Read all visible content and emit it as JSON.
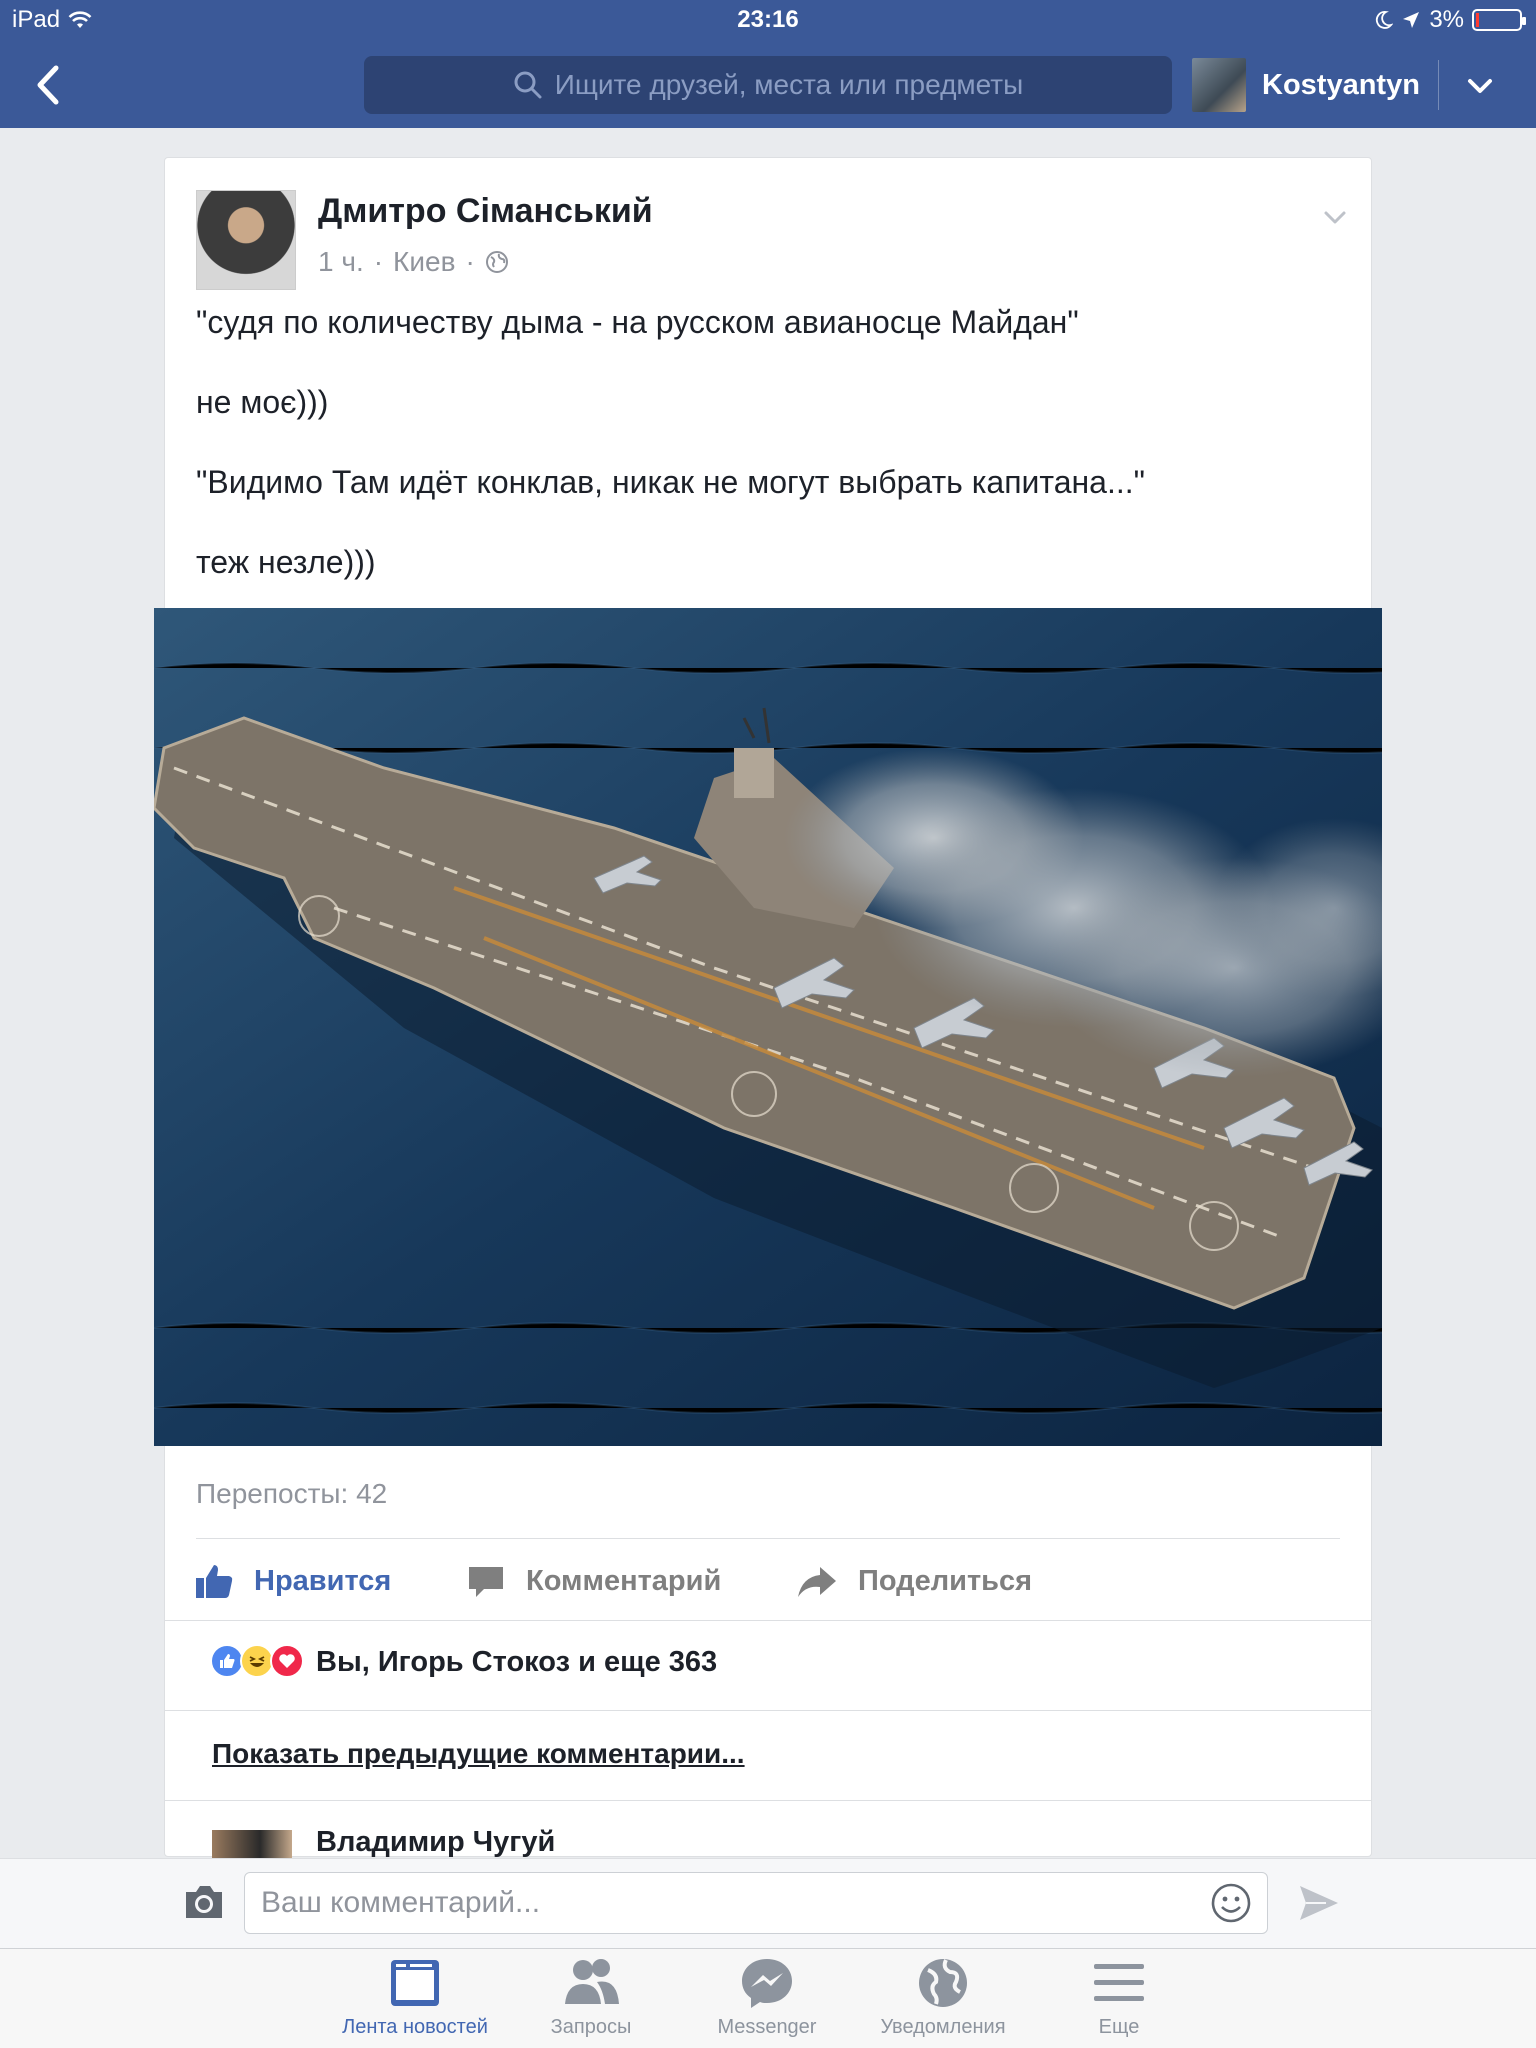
{
  "status_bar": {
    "device": "iPad",
    "time": "23:16",
    "battery_pct": "3%",
    "battery_level": 0.03
  },
  "header": {
    "search_placeholder": "Ищите друзей, места или предметы",
    "user_name": "Kostyantyn"
  },
  "post": {
    "author": "Дмитро Сіманський",
    "time": "1 ч.",
    "location": "Киев",
    "sep": "·",
    "paragraphs": [
      "\"судя по количеству дыма - на русском авианосце Майдан\"",
      "не моє)))",
      "\"Видимо Там идёт конклав, никак не могут выбрать капитана...\"",
      "теж незле)))"
    ],
    "reposts": "Перепосты: 42",
    "actions": {
      "like": "Нравится",
      "comment": "Комментарий",
      "share": "Поделиться"
    },
    "reactions_text": "Вы, Игорь Стокоз и еще 363",
    "show_previous": "Показать предыдущие комментарии...",
    "commenter": "Владимир Чугуй"
  },
  "composer": {
    "placeholder": "Ваш комментарий..."
  },
  "tabs": [
    {
      "label": "Лента новостей",
      "icon": "news-feed-icon"
    },
    {
      "label": "Запросы",
      "icon": "friend-requests-icon"
    },
    {
      "label": "Messenger",
      "icon": "messenger-icon"
    },
    {
      "label": "Уведомления",
      "icon": "globe-icon"
    },
    {
      "label": "Еще",
      "icon": "menu-icon"
    }
  ],
  "colors": {
    "brand": "#3b5998",
    "link_blue": "#4267b2",
    "muted": "#90949c"
  }
}
